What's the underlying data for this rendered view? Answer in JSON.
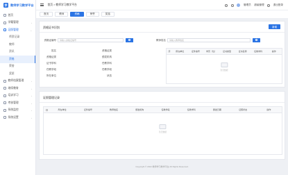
{
  "app": {
    "logo_mark": "学",
    "title": "教师学习教学平台"
  },
  "sidebar": {
    "items": [
      {
        "label": "首页"
      },
      {
        "label": "学籍管理"
      },
      {
        "label": "证照管理"
      }
    ],
    "sub_items": [
      {
        "label": "师资记录"
      },
      {
        "label": "教师"
      },
      {
        "label": "资讯"
      },
      {
        "label": "资格"
      },
      {
        "label": "荣誉"
      },
      {
        "label": "奖惩"
      }
    ],
    "items_after": [
      {
        "label": "教师档案管理"
      },
      {
        "label": "继续教育"
      },
      {
        "label": "培训学习"
      },
      {
        "label": "考核管理"
      },
      {
        "label": "系统监控"
      },
      {
        "label": "系统设置"
      }
    ]
  },
  "topbar": {
    "breadcrumb": "首页  >  教师学习教学平台",
    "user": "管理员",
    "role": "超级管理",
    "logout": "退出登录"
  },
  "tabs": [
    {
      "label": "首页"
    },
    {
      "label": "教师"
    },
    {
      "label": "资格"
    },
    {
      "label": "荣誉"
    },
    {
      "label": "奖惩"
    }
  ],
  "card1": {
    "title": "资格证书识别",
    "add_button": "新增",
    "left": {
      "search_label": "资格证编号",
      "search_placeholder": "请输入资格证编号",
      "fields": [
        "姓名",
        "资格证类",
        "证书学科",
        "任教学段",
        "所在单位"
      ],
      "fields_right": [
        "资格证类",
        "颁发机构",
        "任教学科",
        "任教学段",
        "状态"
      ]
    },
    "right": {
      "search_label": "教师姓名",
      "search_placeholder": "请输入教师姓名",
      "columns": [
        "序",
        "所在单位",
        "证件编号",
        "学历（位）",
        "证书类型",
        "证书名称",
        "任教学科",
        "操作"
      ],
      "empty_text": "暂无数据"
    }
  },
  "card2": {
    "title": "证照管理记录",
    "columns": [
      "所在单位",
      "证件编号",
      "教师姓名",
      "颁发机构",
      "任教学段",
      "任教学科",
      "颁发日期",
      "证照状态",
      "操作"
    ],
    "empty_text": "暂无数据"
  },
  "footer": "Copyright © 2022 教师学习教学平台 All Rights Reserved."
}
